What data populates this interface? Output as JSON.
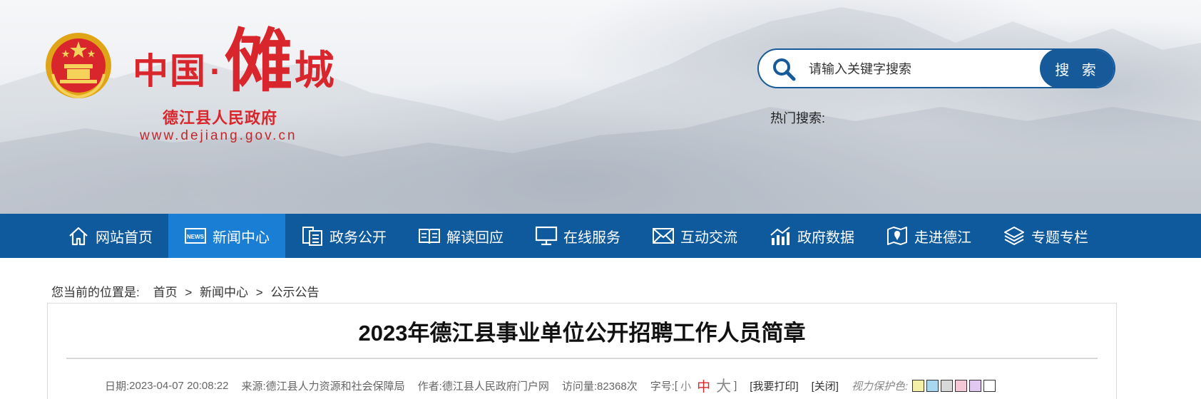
{
  "header": {
    "logo_main": "中国",
    "logo_dot": "·",
    "logo_big": "傩",
    "logo_end": "城",
    "logo_sub": "德江县人民政府",
    "logo_url": "www.dejiang.gov.cn",
    "search_placeholder": "请输入关键字搜索",
    "search_button": "搜 索",
    "hot_search_label": "热门搜索:"
  },
  "nav": {
    "items": [
      {
        "label": "网站首页",
        "icon": "home-icon"
      },
      {
        "label": "新闻中心",
        "icon": "news-icon",
        "active": true
      },
      {
        "label": "政务公开",
        "icon": "document-icon"
      },
      {
        "label": "解读回应",
        "icon": "book-icon"
      },
      {
        "label": "在线服务",
        "icon": "monitor-icon"
      },
      {
        "label": "互动交流",
        "icon": "envelope-icon"
      },
      {
        "label": "政府数据",
        "icon": "chart-icon"
      },
      {
        "label": "走进德江",
        "icon": "map-icon"
      },
      {
        "label": "专题专栏",
        "icon": "layers-icon"
      }
    ]
  },
  "breadcrumb": {
    "prefix": "您当前的位置是:",
    "items": [
      "首页",
      "新闻中心",
      "公示公告"
    ],
    "separator": ">"
  },
  "article": {
    "title": "2023年德江县事业单位公开招聘工作人员简章",
    "date_label": "日期:",
    "date": "2023-04-07 20:08:22",
    "source_label": "来源:",
    "source": "德江县人力资源和社会保障局",
    "author_label": "作者:",
    "author": "德江县人民政府门户网",
    "views_label": "访问量:",
    "views": "82368次",
    "fontsize_label": "字号:",
    "bracket_open": "[",
    "bracket_close": "]",
    "fs_small": "小",
    "fs_medium": "中",
    "fs_large": "大",
    "print": "[我要打印]",
    "close": "[关闭]",
    "eye_care_label": "视力保护色:",
    "swatches": [
      "#f5f0a8",
      "#a8d8f0",
      "#d8d8d8",
      "#f5c8d8",
      "#e0c8f0",
      "#ffffff"
    ]
  },
  "colors": {
    "brand_red": "#d8262c",
    "nav_blue": "#0f5a9c",
    "nav_active": "#1a7fd4"
  }
}
